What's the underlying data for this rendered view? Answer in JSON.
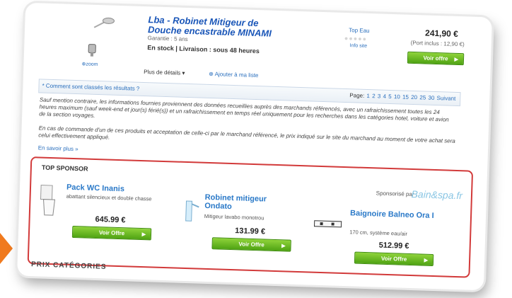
{
  "product": {
    "title": "Lba - Robinet Mitigeur de Douche encastrable MINAMI",
    "guarantee": "Garantie : 5 ans",
    "stock": "En stock | Livraison : sous 48 heures",
    "zoom_label": "zoom",
    "more_details": "Plus de détails",
    "add_list": "Ajouter à ma liste",
    "merchant_label": "Top Eau",
    "merchant_info": "Info site",
    "price": "241,90 €",
    "shipping": "(Port inclus : 12,90 €)",
    "offer_button": "Voir offre"
  },
  "sort": {
    "link": "* Comment sont classés les résultats ?",
    "page_label": "Page:",
    "pages": [
      "1",
      "2",
      "3",
      "4",
      "5",
      "10",
      "15",
      "20",
      "25",
      "30"
    ],
    "next": "Suivant"
  },
  "notes": {
    "p1": "Sauf mention contraire, les informations fournies proviennent des données recueillies auprès des marchands référencés, avec un rafraichissement toutes les 24 heures maximum (sauf week-end et jour(s) férié(s)) et un rafraichissement en temps réel uniquement pour les recherches dans les catégories hotel, voiture et avion de la section voyages.",
    "p2": "En cas de commande d'un de ces produits et acceptation de celle-ci par le marchand référencé, le prix indiqué sur le site du marchand au moment de votre achat sera celui effectivement appliqué.",
    "more": "En savoir plus »"
  },
  "sponsor": {
    "title": "TOP SPONSOR",
    "by": "Sponsorisé par :",
    "logo": "Bain&spa.fr",
    "items": [
      {
        "title": "Pack WC Inanis",
        "desc": "abattant silencieux et double chasse",
        "price": "645.99 €",
        "button": "Voir Offre"
      },
      {
        "title": "Robinet mitigeur Ondato",
        "desc": "Mitigeur lavabo monotrou",
        "price": "131.99 €",
        "button": "Voir Offre"
      },
      {
        "title": "Baignoire Balneo Ora I",
        "desc": "170 cm, système eau/air",
        "price": "512.99 €",
        "button": "Voir Offre"
      }
    ]
  },
  "footer": {
    "categories": "PRIX CATÉGORIES"
  },
  "colors": {
    "accent": "#d23a3a",
    "link": "#2a6fbd",
    "button": "#6ec021",
    "arrow": "#f07a1e"
  }
}
